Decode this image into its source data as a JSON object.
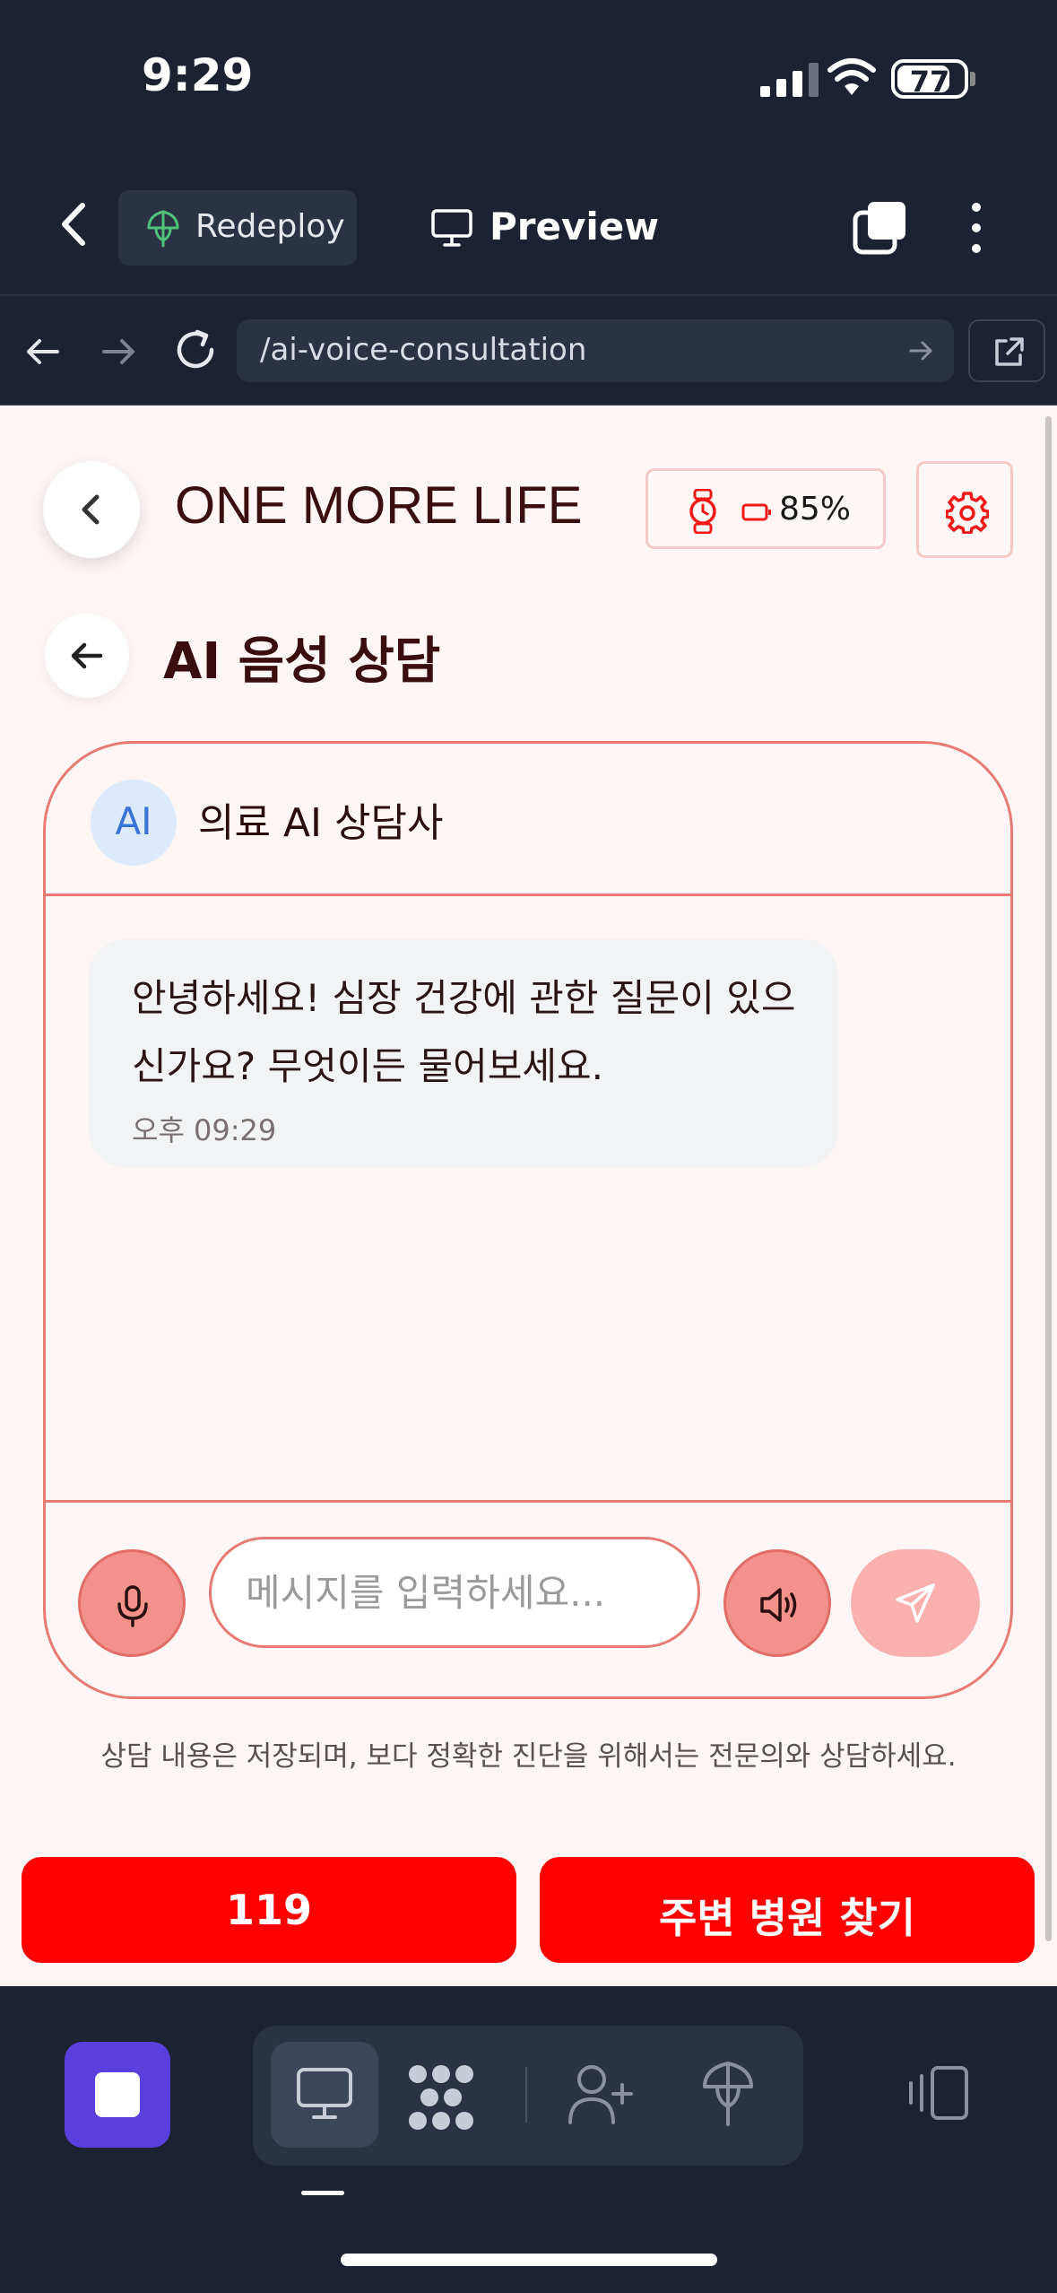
{
  "status_bar": {
    "time": "9:29",
    "battery_level": "77"
  },
  "app_bar": {
    "redeploy_label": "Redeploy",
    "preview_label": "Preview"
  },
  "browser": {
    "url": "/ai-voice-consultation"
  },
  "header": {
    "brand": "ONE MORE LIFE",
    "device_battery": "85%"
  },
  "page": {
    "title": "AI 음성 상담"
  },
  "chat": {
    "avatar_text": "AI",
    "agent_name": "의료 AI 상담사",
    "messages": [
      {
        "sender": "ai",
        "text": "안녕하세요! 심장 건강에 관한 질문이 있으신가요? 무엇이든 물어보세요.",
        "time": "오후 09:29"
      }
    ],
    "input_placeholder": "메시지를 입력하세요..."
  },
  "disclaimer": "상담 내용은 저장되며, 보다 정확한 진단을 위해서는 전문의와 상담하세요.",
  "actions": {
    "emergency_label": "119",
    "hospital_label": "주변 병원 찾기"
  },
  "colors": {
    "accent_red": "#ff0000",
    "border_red": "#e77a74",
    "stop_purple": "#5b3fdc"
  }
}
